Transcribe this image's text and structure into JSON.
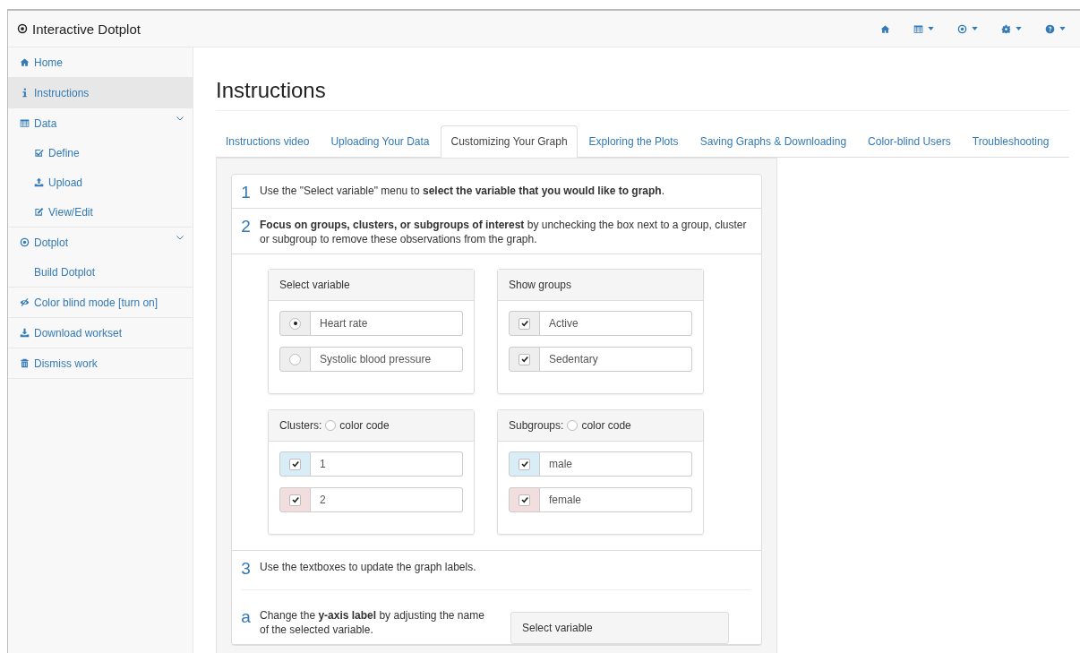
{
  "navbar": {
    "title": "Interactive Dotplot"
  },
  "sidebar": {
    "items": [
      {
        "label": "Home",
        "selected": false
      },
      {
        "label": "Instructions",
        "selected": true
      },
      {
        "label": "Data",
        "selected": false,
        "expanded": true,
        "children": [
          {
            "label": "Define",
            "selected": false
          },
          {
            "label": "Upload",
            "selected": false
          },
          {
            "label": "View/Edit",
            "selected": false
          }
        ]
      },
      {
        "label": "Dotplot",
        "selected": false,
        "expanded": true,
        "children": [
          {
            "label": "Build Dotplot",
            "selected": false
          }
        ]
      },
      {
        "label": "Color blind mode [turn on]",
        "selected": false
      },
      {
        "label": "Download workset",
        "selected": false
      },
      {
        "label": "Dismiss work",
        "selected": false
      }
    ]
  },
  "page_title": "Instructions",
  "tabs": [
    {
      "label": "Instructions video",
      "selected": false
    },
    {
      "label": "Uploading Your Data",
      "selected": false
    },
    {
      "label": "Customizing Your Graph",
      "selected": true
    },
    {
      "label": "Exploring the Plots",
      "selected": false
    },
    {
      "label": "Saving Graphs & Downloading",
      "selected": false
    },
    {
      "label": "Color-blind Users",
      "selected": false
    },
    {
      "label": "Troubleshooting",
      "selected": false
    }
  ],
  "steps": [
    {
      "number": "1",
      "text": "Use the \"Select variable\" menu to **select the variable that you would like to graph**."
    },
    {
      "number": "2",
      "text": "**Focus on groups, clusters, or subgroups of interest** by unchecking the box next to a group, cluster or subgroup to remove these observations from the graph.",
      "panels": [
        {
          "title": "Select variable",
          "options": [
            {
              "kind": "radio",
              "label": "Heart rate",
              "selected": true
            },
            {
              "kind": "radio",
              "label": "Systolic blood pressure",
              "selected": false
            }
          ]
        },
        {
          "title": "Show groups",
          "options": [
            {
              "kind": "checkbox",
              "label": "Active",
              "checked": true
            },
            {
              "kind": "checkbox",
              "label": "Sedentary",
              "checked": true
            }
          ]
        },
        {
          "title": "Clusters:",
          "toggle": {
            "label": "color code",
            "on": false
          },
          "options": [
            {
              "kind": "checkbox",
              "label": "1",
              "checked": true,
              "color": "#d9edf7"
            },
            {
              "kind": "checkbox",
              "label": "2",
              "checked": true,
              "color": "#f2dede"
            }
          ]
        },
        {
          "title": "Subgroups:",
          "toggle": {
            "label": "color code",
            "on": false
          },
          "options": [
            {
              "kind": "checkbox",
              "label": "male",
              "checked": true,
              "color": "#d9edf7"
            },
            {
              "kind": "checkbox",
              "label": "female",
              "checked": true,
              "color": "#f2dede"
            }
          ]
        }
      ]
    },
    {
      "number": "3",
      "text": "Use the textboxes to update the graph labels.",
      "substeps": [
        {
          "letter": "a",
          "text": "Change the **y-axis label** by adjusting the name of the selected variable.",
          "panel_title": "Select variable"
        }
      ]
    }
  ]
}
